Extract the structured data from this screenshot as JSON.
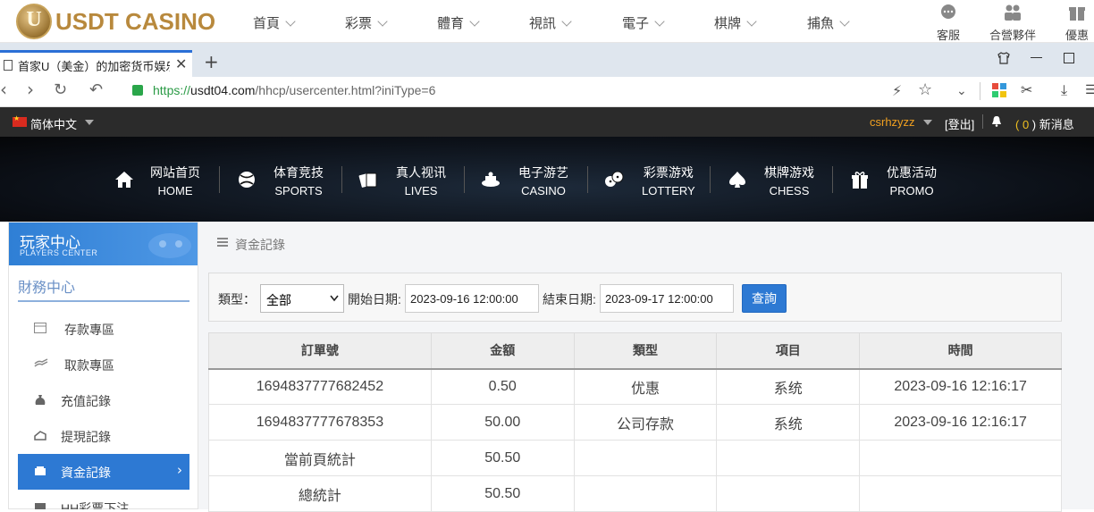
{
  "site": {
    "logo_letter": "U",
    "logo_text": "USDT CASINO",
    "nav": [
      "首頁",
      "彩票",
      "體育",
      "視訊",
      "電子",
      "棋牌",
      "捕魚"
    ],
    "icons": [
      {
        "label": "客服",
        "icon": "chat-icon"
      },
      {
        "label": "合營夥伴",
        "icon": "partners-icon"
      },
      {
        "label": "優惠",
        "icon": "gift-icon"
      }
    ]
  },
  "browser": {
    "tab_title": "首家U（美金）的加密货币娱乐",
    "url_scheme": "https://",
    "url_host": "usdt04.com",
    "url_path": "/hhcp/usercenter.html?iniType=6",
    "new_tab": "+"
  },
  "topbar": {
    "language": "简体中文",
    "username": "csrhzyzz",
    "logout": "[登出]",
    "messages_prefix": "( ",
    "messages_count": "0",
    "messages_suffix": " ) 新消息"
  },
  "hero_nav": [
    {
      "cn": "网站首页",
      "en": "HOME",
      "icon": "home-icon"
    },
    {
      "cn": "体育竞技",
      "en": "SPORTS",
      "icon": "ball-icon"
    },
    {
      "cn": "真人视讯",
      "en": "LIVES",
      "icon": "cards-icon"
    },
    {
      "cn": "电子游艺",
      "en": "CASINO",
      "icon": "slot-icon"
    },
    {
      "cn": "彩票游戏",
      "en": "LOTTERY",
      "icon": "dice-icon"
    },
    {
      "cn": "棋牌游戏",
      "en": "CHESS",
      "icon": "spade-icon"
    },
    {
      "cn": "优惠活动",
      "en": "PROMO",
      "icon": "gift-icon"
    }
  ],
  "sidebar": {
    "title_cn": "玩家中心",
    "title_en": "PLAYERS CENTER",
    "section": "財務中心",
    "items": [
      {
        "label": "存款專區",
        "icon": "deposit-icon"
      },
      {
        "label": "取款專區",
        "icon": "withdraw-icon"
      },
      {
        "label": "充值記錄",
        "icon": "moneybag-icon"
      },
      {
        "label": "提現記錄",
        "icon": "cashout-icon"
      },
      {
        "label": "資金記錄",
        "icon": "funds-icon",
        "active": true
      },
      {
        "label": "HH彩票下注",
        "icon": "lottery-icon"
      }
    ]
  },
  "main": {
    "breadcrumb": "資金記錄",
    "filter": {
      "type_label": "類型：",
      "type_value": "全部",
      "start_label": "開始日期:",
      "start_value": "2023-09-16 12:00:00",
      "end_label": "結束日期:",
      "end_value": "2023-09-17 12:00:00",
      "query_button": "查詢"
    },
    "table": {
      "headers": [
        "訂單號",
        "金額",
        "類型",
        "項目",
        "時間"
      ],
      "rows": [
        [
          "1694837777682452",
          "0.50",
          "优惠",
          "系统",
          "2023-09-16 12:16:17"
        ],
        [
          "1694837777678353",
          "50.00",
          "公司存款",
          "系统",
          "2023-09-16 12:16:17"
        ],
        [
          "當前頁統計",
          "50.50",
          "",
          "",
          ""
        ],
        [
          "總統計",
          "50.50",
          "",
          "",
          ""
        ]
      ]
    }
  },
  "colors": {
    "accent": "#2d79d3",
    "gold": "#b8893d",
    "username": "#f0a020"
  }
}
